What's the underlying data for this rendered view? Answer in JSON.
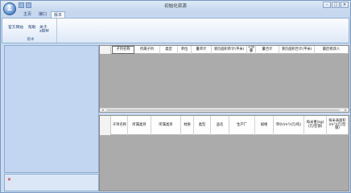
{
  "window": {
    "title": "初始化资源",
    "logo_glyph": "Σ",
    "controls": [
      "minimize-icon",
      "maximize-icon",
      "close-icon"
    ],
    "control_glyphs": [
      "–",
      "□",
      "✕"
    ]
  },
  "ribbon": {
    "tabs": [
      "主页",
      "接口",
      "版本"
    ],
    "active_tab": "版本",
    "group": {
      "buttons": [
        "官方网站",
        "帮助",
        "关于xBIM"
      ],
      "label": "版本"
    }
  },
  "nav_pane": {
    "footer_close": "✕"
  },
  "grid_top": {
    "columns": [
      "子目名称",
      "所属子目",
      "类型",
      "单位",
      "量单计",
      "清页面积单计(平米)",
      "工程量",
      "量合计",
      "清页面积合计(平米)",
      "最后修改人"
    ]
  },
  "grid_bottom": {
    "columns": [
      "子目名称",
      "所属类目",
      "所属类目",
      "材质",
      "类型",
      "品名",
      "生产厂",
      "规格",
      "単价(m³)(元/吨)",
      "每米重(kg)(元/型钢)",
      "每米表面积(m²)(元/型钢)"
    ]
  },
  "colors": {
    "frame": "#c9dbf0",
    "nav_pane": "#c2d6f1",
    "grid_empty": "#ababab",
    "accent": "#2c5e9e"
  }
}
